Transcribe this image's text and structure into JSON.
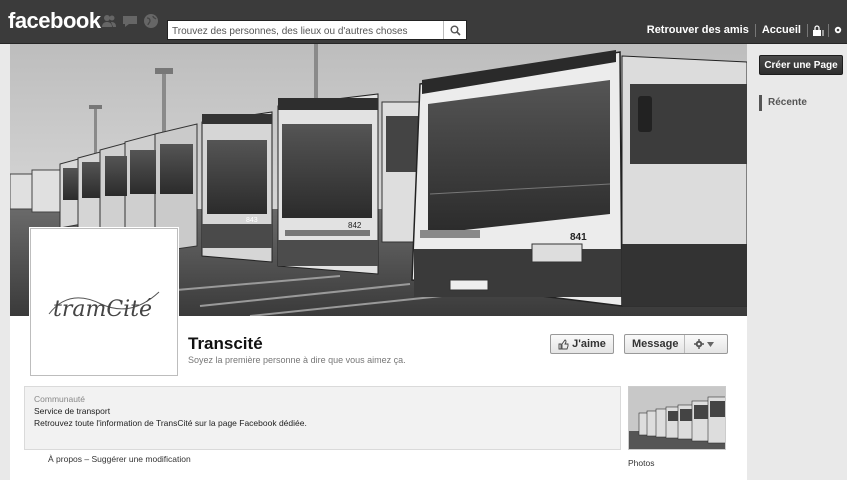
{
  "topbar": {
    "logo": "facebook",
    "search_placeholder": "Trouvez des personnes, des lieux ou d'autres choses",
    "links": [
      "Retrouver des amis",
      "Accueil"
    ],
    "jewel_icons": [
      "friend-requests-icon",
      "messages-icon",
      "notifications-globe-icon"
    ]
  },
  "page": {
    "name": "Transcité",
    "like_prompt": "Soyez la première personne à dire que vous aimez ça.",
    "like_button": "J'aime",
    "message_button": "Message",
    "logo_text": "tramCité",
    "about": {
      "category_group": "Communauté",
      "category": "Service de transport",
      "description": "Retrouvez toute l'information de TransCité sur la page Facebook dédiée."
    },
    "about_link": "À propos",
    "suggest_link": "Suggérer une modification",
    "link_separator": "–",
    "photos_label": "Photos",
    "bus_numbers": [
      "841",
      "842",
      "843",
      "841"
    ]
  },
  "sidebar": {
    "create_page": "Créer une Page",
    "recent": "Récente"
  },
  "colors": {
    "topbar": "#3b3b3b",
    "background": "#e9e9e9"
  }
}
